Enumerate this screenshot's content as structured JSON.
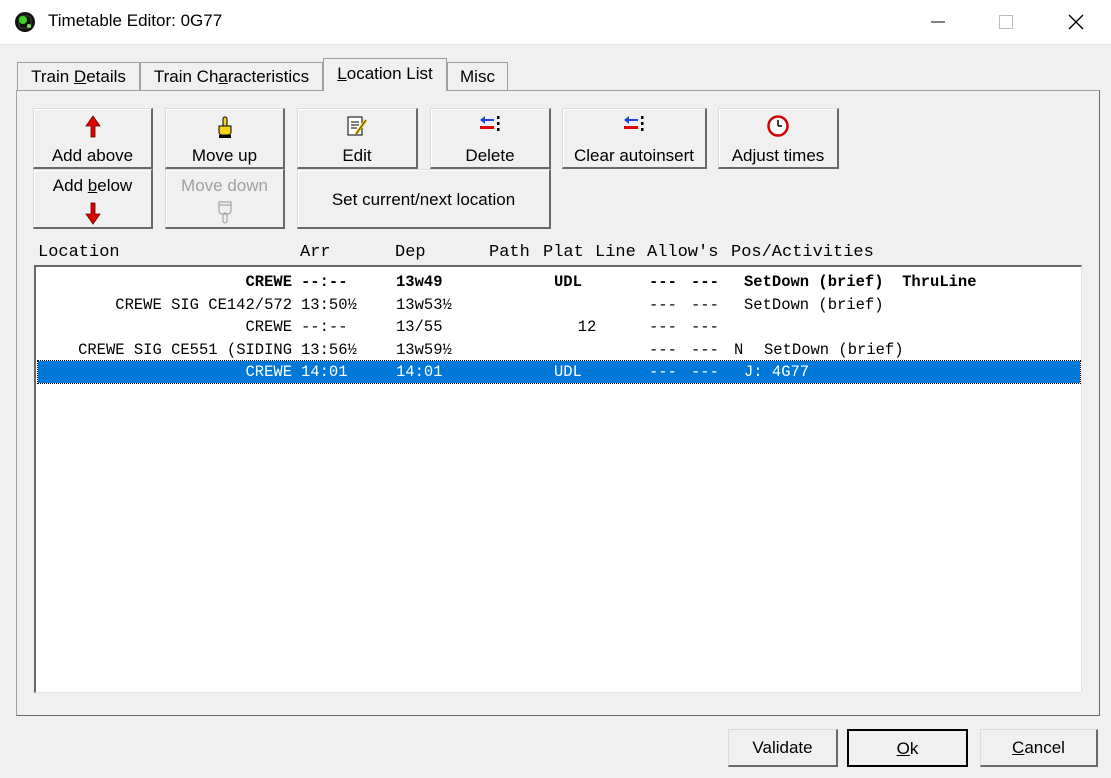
{
  "window": {
    "title": "Timetable Editor: 0G77",
    "icon": "railway-signal-icon"
  },
  "tabs": [
    {
      "pre": "Train ",
      "acc": "D",
      "post": "etails",
      "active": false
    },
    {
      "pre": "Train Ch",
      "acc": "a",
      "post": "racteristics",
      "active": false
    },
    {
      "pre": "",
      "acc": "L",
      "post": "ocation List",
      "active": true
    },
    {
      "pre": "Misc",
      "acc": "",
      "post": "",
      "active": false
    }
  ],
  "toolbar": {
    "add_above": "Add above",
    "add_below_pre": "Add ",
    "add_below_acc": "b",
    "add_below_post": "elow",
    "move_up": "Move up",
    "move_down": "Move down",
    "edit": "Edit",
    "delete": "Delete",
    "set_current_next": "Set current/next location",
    "clear_autoinsert": "Clear autoinsert",
    "adjust_times": "Adjust times"
  },
  "list": {
    "columns": [
      "Location",
      "Arr",
      "Dep",
      "Path",
      "Plat",
      "Line",
      "Allow's",
      "Pos/Activities"
    ],
    "rows": [
      {
        "location": "CREWE",
        "arr": "--:--",
        "dep": "13w49",
        "plat": "",
        "line": "UDL",
        "allow1": "---",
        "allow2": "---",
        "pos": "",
        "activities": "SetDown (brief)  ThruLine",
        "bold": true,
        "selected": false
      },
      {
        "location": "CREWE SIG CE142/572",
        "arr": "13:50½",
        "dep": "13w53½",
        "plat": "",
        "line": "",
        "allow1": "---",
        "allow2": "---",
        "pos": "",
        "activities": "SetDown (brief)",
        "bold": false,
        "selected": false
      },
      {
        "location": "CREWE",
        "arr": "--:--",
        "dep": "13/55",
        "plat": "12",
        "line": "",
        "allow1": "---",
        "allow2": "---",
        "pos": "",
        "activities": "",
        "bold": false,
        "selected": false
      },
      {
        "location": "CREWE SIG CE551 (SIDING",
        "arr": "13:56½",
        "dep": "13w59½",
        "plat": "",
        "line": "",
        "allow1": "---",
        "allow2": "---",
        "pos": "N",
        "activities": "SetDown (brief)",
        "bold": false,
        "selected": false
      },
      {
        "location": "CREWE",
        "arr": "14:01",
        "dep": "14:01",
        "plat": "",
        "line": "UDL",
        "allow1": "---",
        "allow2": "---",
        "pos": "",
        "activities": "J: 4G77",
        "bold": false,
        "selected": true
      }
    ]
  },
  "dialog_buttons": {
    "validate": "Validate",
    "ok_acc": "O",
    "ok_post": "k",
    "cancel_acc": "C",
    "cancel_post": "ancel"
  },
  "colors": {
    "selection": "#0078d7",
    "face": "#f0f0f0",
    "arrow_red": "#e00000"
  }
}
